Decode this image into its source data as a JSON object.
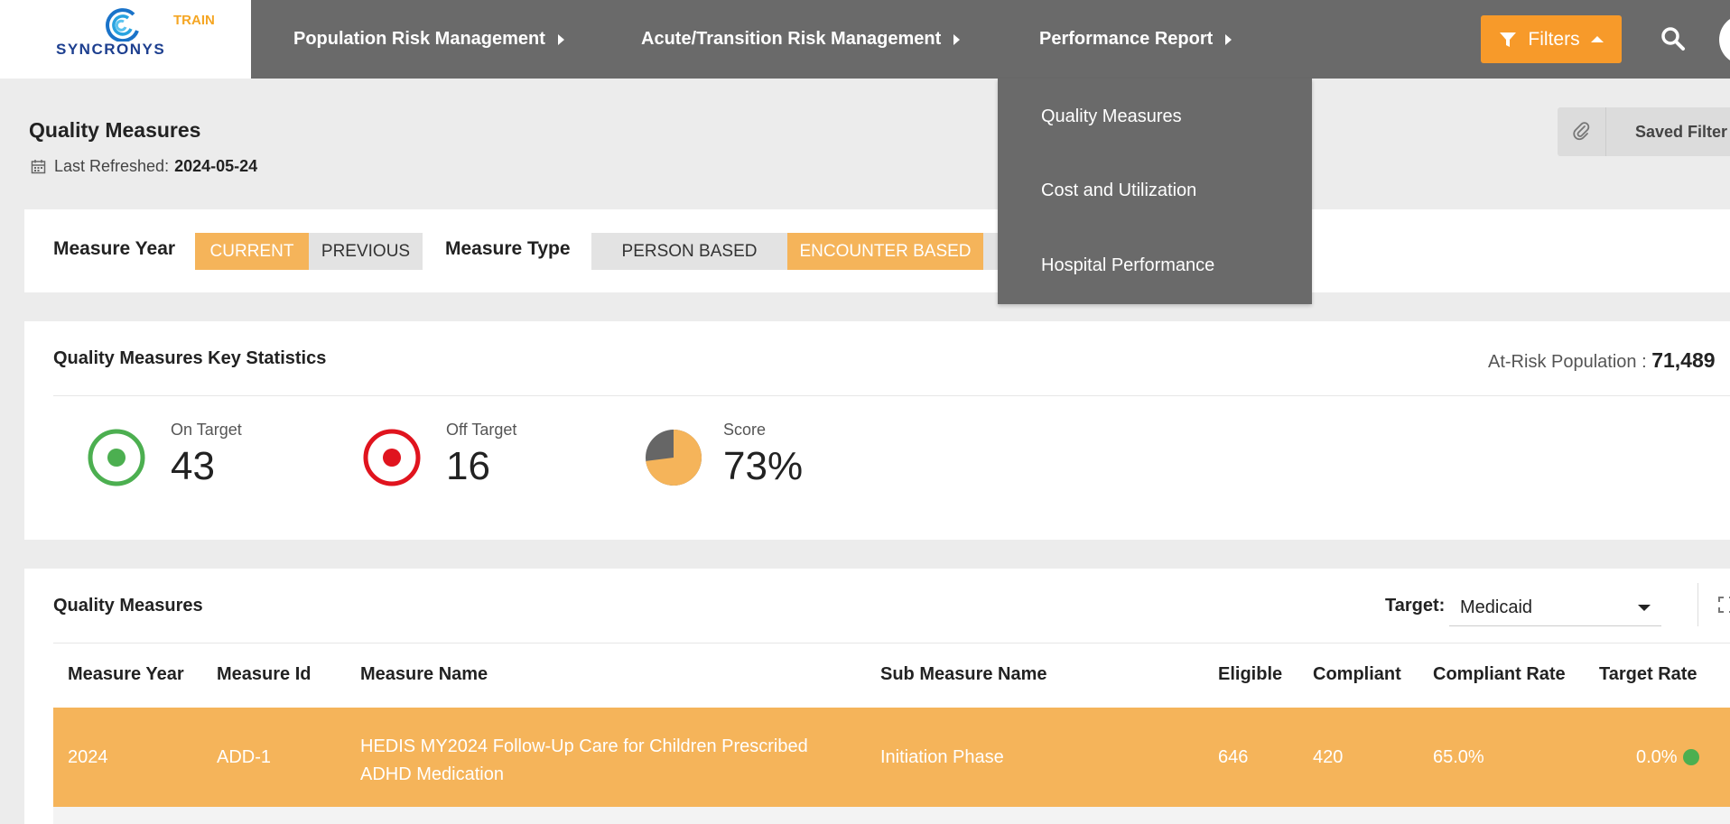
{
  "brand": {
    "name": "SYNCRONYS",
    "env_badge": "TRAIN"
  },
  "nav": {
    "items": [
      {
        "label": "Population Risk Management"
      },
      {
        "label": "Acute/Transition Risk Management"
      },
      {
        "label": "Performance Report"
      }
    ],
    "filters_label": "Filters",
    "icons": [
      "filter-icon",
      "search-icon"
    ]
  },
  "performance_menu": {
    "items": [
      "Quality Measures",
      "Cost and Utilization",
      "Hospital Performance"
    ]
  },
  "header": {
    "title": "Quality Measures",
    "refreshed_label": "Last Refreshed:",
    "refreshed_date": "2024-05-24",
    "saved_filter_label": "Saved Filter"
  },
  "selector": {
    "measure_year_label": "Measure Year",
    "year_options": [
      {
        "label": "CURRENT",
        "active": true
      },
      {
        "label": "PREVIOUS",
        "active": false
      }
    ],
    "measure_type_label": "Measure Type",
    "type_options": [
      {
        "label": "PERSON BASED",
        "active": false
      },
      {
        "label": "ENCOUNTER BASED",
        "active": true
      }
    ]
  },
  "stats": {
    "title": "Quality Measures Key Statistics",
    "at_risk_label": "At-Risk Population :",
    "at_risk_value": "71,489",
    "on_target_label": "On Target",
    "on_target_value": "43",
    "off_target_label": "Off Target",
    "off_target_value": "16",
    "score_label": "Score",
    "score_value": "73%",
    "score_fraction": 0.73
  },
  "table": {
    "title": "Quality Measures",
    "target_label": "Target:",
    "target_value": "Medicaid",
    "columns": [
      "Measure Year",
      "Measure Id",
      "Measure Name",
      "Sub Measure Name",
      "Eligible",
      "Compliant",
      "Compliant Rate",
      "Target Rate"
    ],
    "rows": [
      {
        "year": "2024",
        "id": "ADD-1",
        "name_line1": "HEDIS MY2024 Follow-Up Care for Children Prescribed",
        "name_line2": "ADHD Medication",
        "sub_measure": "Initiation Phase",
        "eligible": "646",
        "compliant": "420",
        "compliant_rate": "65.0%",
        "target_rate": "0.0%",
        "status": "on-target"
      }
    ]
  },
  "colors": {
    "nav_bg": "#6a6a6a",
    "accent_orange": "#f79a2a",
    "active_toggle": "#f5b45a",
    "on_target_green": "#4caf50",
    "off_target_red": "#e0141e",
    "brand_blue": "#1d3f8f"
  }
}
